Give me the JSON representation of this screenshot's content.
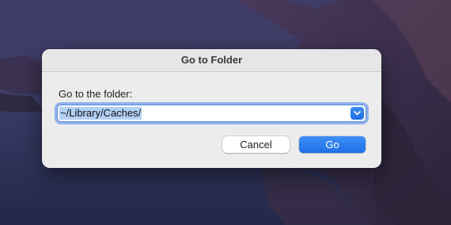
{
  "dialog": {
    "title": "Go to Folder",
    "prompt": "Go to the folder:",
    "path_value": "~/Library/Caches/",
    "cancel_label": "Cancel",
    "go_label": "Go"
  },
  "icons": {
    "dropdown": "chevron-down-icon"
  },
  "colors": {
    "accent": "#1e6fe8",
    "selection": "#b3d0f7",
    "dialog_bg": "#ececec"
  }
}
